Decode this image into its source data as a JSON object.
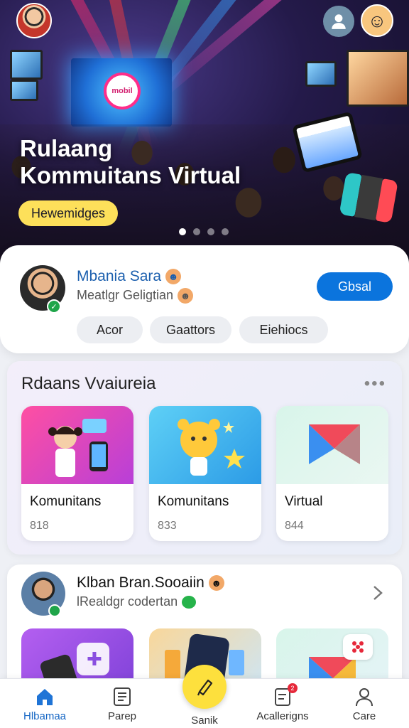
{
  "hero": {
    "title_line1": "Rulaang",
    "title_line2": "Kommuitans Virtual",
    "tag": "Hewemidges",
    "screen_logo": "mobil",
    "slides_total": 4,
    "slide_active": 1
  },
  "profile": {
    "name": "Mbania Sara",
    "subtitle": "Meatlgr Geligtian",
    "action_button": "Gbsal",
    "chips": [
      "Acor",
      "Gaattors",
      "Eiehiocs"
    ]
  },
  "section_rooms": {
    "title": "Rdaans Vvaiureia",
    "more": "•••",
    "tiles": [
      {
        "label": "Komunitans",
        "count": "818"
      },
      {
        "label": "Komunitans",
        "count": "833"
      },
      {
        "label": "Virtual",
        "count": "844"
      }
    ]
  },
  "section_feed": {
    "name": "Klban Bran.Sooaiin",
    "subtitle": "lRealdgr codertan"
  },
  "nav": {
    "items": [
      {
        "label": "Hlbamaa",
        "icon": "home-icon"
      },
      {
        "label": "Parep",
        "icon": "list-icon"
      },
      {
        "label": "Sanik",
        "icon": "pen-icon"
      },
      {
        "label": "Acallerigns",
        "icon": "notes-icon"
      },
      {
        "label": "Care",
        "icon": "person-icon"
      }
    ],
    "badge": "2"
  },
  "colors": {
    "primary": "#0b74dd",
    "tag_yellow": "#fde05a",
    "fab_yellow": "#fde03d",
    "active_nav": "#1566c4"
  }
}
